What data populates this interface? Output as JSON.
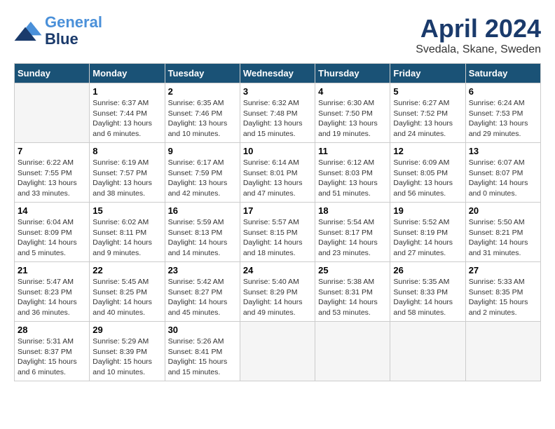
{
  "header": {
    "logo_line1": "General",
    "logo_line2": "Blue",
    "month": "April 2024",
    "location": "Svedala, Skane, Sweden"
  },
  "days_of_week": [
    "Sunday",
    "Monday",
    "Tuesday",
    "Wednesday",
    "Thursday",
    "Friday",
    "Saturday"
  ],
  "weeks": [
    [
      {
        "day": "",
        "info": ""
      },
      {
        "day": "1",
        "info": "Sunrise: 6:37 AM\nSunset: 7:44 PM\nDaylight: 13 hours\nand 6 minutes."
      },
      {
        "day": "2",
        "info": "Sunrise: 6:35 AM\nSunset: 7:46 PM\nDaylight: 13 hours\nand 10 minutes."
      },
      {
        "day": "3",
        "info": "Sunrise: 6:32 AM\nSunset: 7:48 PM\nDaylight: 13 hours\nand 15 minutes."
      },
      {
        "day": "4",
        "info": "Sunrise: 6:30 AM\nSunset: 7:50 PM\nDaylight: 13 hours\nand 19 minutes."
      },
      {
        "day": "5",
        "info": "Sunrise: 6:27 AM\nSunset: 7:52 PM\nDaylight: 13 hours\nand 24 minutes."
      },
      {
        "day": "6",
        "info": "Sunrise: 6:24 AM\nSunset: 7:53 PM\nDaylight: 13 hours\nand 29 minutes."
      }
    ],
    [
      {
        "day": "7",
        "info": "Sunrise: 6:22 AM\nSunset: 7:55 PM\nDaylight: 13 hours\nand 33 minutes."
      },
      {
        "day": "8",
        "info": "Sunrise: 6:19 AM\nSunset: 7:57 PM\nDaylight: 13 hours\nand 38 minutes."
      },
      {
        "day": "9",
        "info": "Sunrise: 6:17 AM\nSunset: 7:59 PM\nDaylight: 13 hours\nand 42 minutes."
      },
      {
        "day": "10",
        "info": "Sunrise: 6:14 AM\nSunset: 8:01 PM\nDaylight: 13 hours\nand 47 minutes."
      },
      {
        "day": "11",
        "info": "Sunrise: 6:12 AM\nSunset: 8:03 PM\nDaylight: 13 hours\nand 51 minutes."
      },
      {
        "day": "12",
        "info": "Sunrise: 6:09 AM\nSunset: 8:05 PM\nDaylight: 13 hours\nand 56 minutes."
      },
      {
        "day": "13",
        "info": "Sunrise: 6:07 AM\nSunset: 8:07 PM\nDaylight: 14 hours\nand 0 minutes."
      }
    ],
    [
      {
        "day": "14",
        "info": "Sunrise: 6:04 AM\nSunset: 8:09 PM\nDaylight: 14 hours\nand 5 minutes."
      },
      {
        "day": "15",
        "info": "Sunrise: 6:02 AM\nSunset: 8:11 PM\nDaylight: 14 hours\nand 9 minutes."
      },
      {
        "day": "16",
        "info": "Sunrise: 5:59 AM\nSunset: 8:13 PM\nDaylight: 14 hours\nand 14 minutes."
      },
      {
        "day": "17",
        "info": "Sunrise: 5:57 AM\nSunset: 8:15 PM\nDaylight: 14 hours\nand 18 minutes."
      },
      {
        "day": "18",
        "info": "Sunrise: 5:54 AM\nSunset: 8:17 PM\nDaylight: 14 hours\nand 23 minutes."
      },
      {
        "day": "19",
        "info": "Sunrise: 5:52 AM\nSunset: 8:19 PM\nDaylight: 14 hours\nand 27 minutes."
      },
      {
        "day": "20",
        "info": "Sunrise: 5:50 AM\nSunset: 8:21 PM\nDaylight: 14 hours\nand 31 minutes."
      }
    ],
    [
      {
        "day": "21",
        "info": "Sunrise: 5:47 AM\nSunset: 8:23 PM\nDaylight: 14 hours\nand 36 minutes."
      },
      {
        "day": "22",
        "info": "Sunrise: 5:45 AM\nSunset: 8:25 PM\nDaylight: 14 hours\nand 40 minutes."
      },
      {
        "day": "23",
        "info": "Sunrise: 5:42 AM\nSunset: 8:27 PM\nDaylight: 14 hours\nand 45 minutes."
      },
      {
        "day": "24",
        "info": "Sunrise: 5:40 AM\nSunset: 8:29 PM\nDaylight: 14 hours\nand 49 minutes."
      },
      {
        "day": "25",
        "info": "Sunrise: 5:38 AM\nSunset: 8:31 PM\nDaylight: 14 hours\nand 53 minutes."
      },
      {
        "day": "26",
        "info": "Sunrise: 5:35 AM\nSunset: 8:33 PM\nDaylight: 14 hours\nand 58 minutes."
      },
      {
        "day": "27",
        "info": "Sunrise: 5:33 AM\nSunset: 8:35 PM\nDaylight: 15 hours\nand 2 minutes."
      }
    ],
    [
      {
        "day": "28",
        "info": "Sunrise: 5:31 AM\nSunset: 8:37 PM\nDaylight: 15 hours\nand 6 minutes."
      },
      {
        "day": "29",
        "info": "Sunrise: 5:29 AM\nSunset: 8:39 PM\nDaylight: 15 hours\nand 10 minutes."
      },
      {
        "day": "30",
        "info": "Sunrise: 5:26 AM\nSunset: 8:41 PM\nDaylight: 15 hours\nand 15 minutes."
      },
      {
        "day": "",
        "info": ""
      },
      {
        "day": "",
        "info": ""
      },
      {
        "day": "",
        "info": ""
      },
      {
        "day": "",
        "info": ""
      }
    ]
  ]
}
